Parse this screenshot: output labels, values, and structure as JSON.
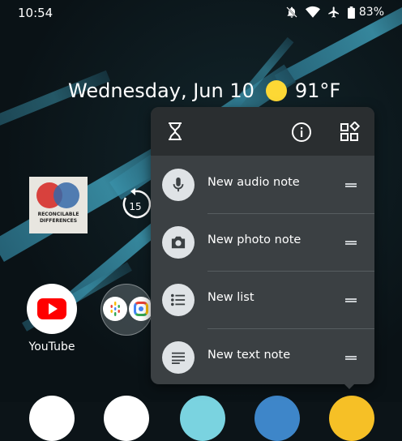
{
  "status_bar": {
    "time": "10:54",
    "battery": "83%",
    "icons": [
      "dnd-off-icon",
      "wifi-icon",
      "airplane-icon",
      "battery-icon"
    ]
  },
  "at_a_glance": {
    "date": "Wednesday, Jun 10",
    "weather_icon": "sun-icon",
    "temperature": "91°F"
  },
  "home": {
    "podcast_widget": {
      "art_line1": "RECONCILABLE",
      "art_line2": "DIFFERENCES",
      "rewind_label": "15"
    },
    "apps": [
      {
        "label": "YouTube",
        "icon": "youtube-icon"
      }
    ],
    "folder": {
      "icons": [
        "google-podcasts-icon",
        "google-lens-icon"
      ]
    }
  },
  "shortcut_menu": {
    "header_icons": [
      "hourglass-icon",
      "app-info-icon",
      "widgets-icon"
    ],
    "items": [
      {
        "label": "New audio note",
        "icon": "mic-icon"
      },
      {
        "label": "New photo note",
        "icon": "camera-icon"
      },
      {
        "label": "New list",
        "icon": "list-icon"
      },
      {
        "label": "New text note",
        "icon": "text-note-icon"
      }
    ]
  },
  "colors": {
    "menu_bg": "#3b4043",
    "menu_header_bg": "#2a2e30",
    "icon_circle": "#dfe3e6",
    "sun": "#fdd835",
    "youtube_red": "#ff0000"
  }
}
